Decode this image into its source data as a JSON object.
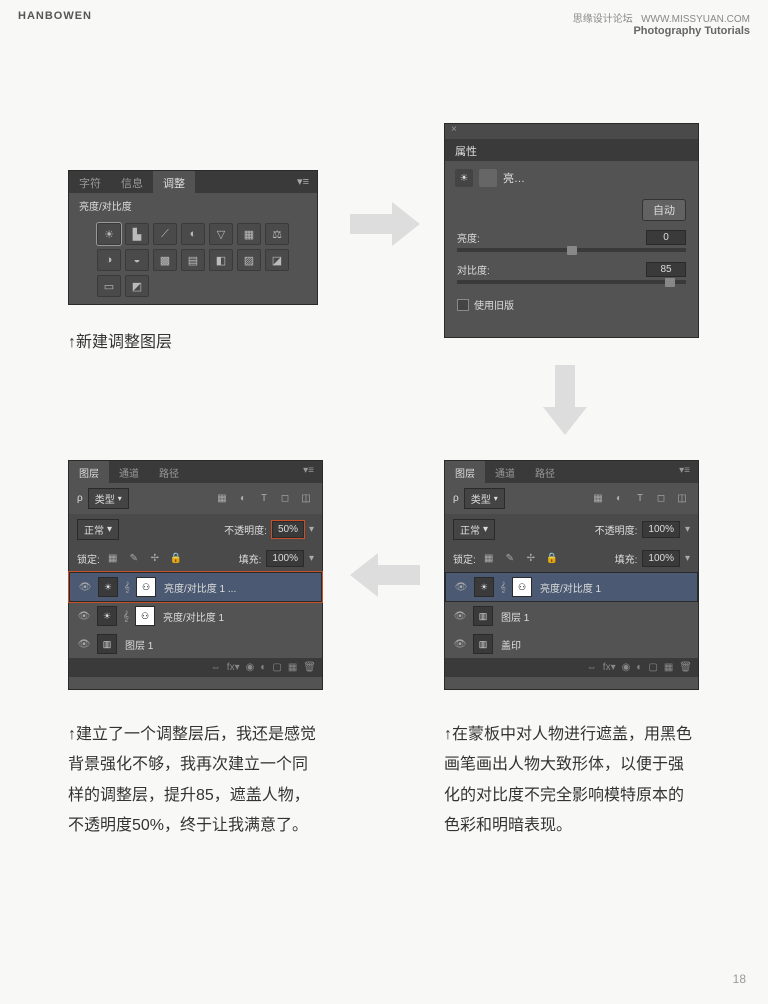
{
  "header": {
    "left": "HANBOWEN",
    "right_top": "思缘设计论坛",
    "right_url": "WWW.MISSYUAN.COM",
    "right_sub": "Photography Tutorials"
  },
  "panel1": {
    "tabs": [
      "字符",
      "信息",
      "调整"
    ],
    "sub": "亮度/对比度",
    "cap": "↑新建调整图层"
  },
  "panel2": {
    "title": "属性",
    "mode": "亮…",
    "auto": "自动",
    "brightness_label": "亮度:",
    "brightness_val": "0",
    "contrast_label": "对比度:",
    "contrast_val": "85",
    "legacy": "使用旧版"
  },
  "layers": {
    "tabs": [
      "图层",
      "通道",
      "路径"
    ],
    "typekind": "类型",
    "blend": "正常",
    "op_label": "不透明度:",
    "op1": "50%",
    "op2": "100%",
    "lock": "锁定:",
    "fill": "填充:",
    "fill1": "100%",
    "fill2": "100%",
    "l1": "亮度/对比度 1 ...",
    "l2": "亮度/对比度 1",
    "l3": "图层 1",
    "l4": "图层 1",
    "l5": "盖印"
  },
  "captions": {
    "left": "↑建立了一个调整层后，我还是感觉背景强化不够，我再次建立一个同样的调整层，提升85，遮盖人物，不透明度50%，终于让我满意了。",
    "right": "↑在蒙板中对人物进行遮盖，用黑色画笔画出人物大致形体，以便于强化的对比度不完全影响模特原本的色彩和明暗表现。"
  },
  "page": "18"
}
